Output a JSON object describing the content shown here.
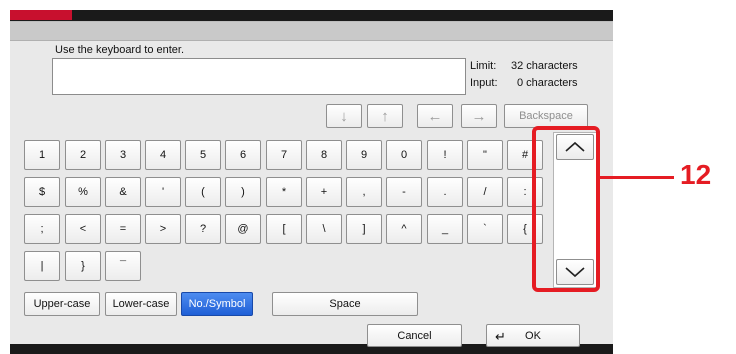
{
  "header": {
    "title": ""
  },
  "prompt": "Use the keyboard to enter.",
  "text_field": {
    "value": ""
  },
  "limits": {
    "limit_label": "Limit:",
    "limit_value": "32 characters",
    "input_label": "Input:",
    "input_value": "0 characters"
  },
  "nav_keys": {
    "down": "↓",
    "up": "↑",
    "left": "←",
    "right": "→",
    "backspace": "Backspace"
  },
  "keys": [
    [
      "1",
      "2",
      "3",
      "4",
      "5",
      "6",
      "7",
      "8",
      "9",
      "0",
      "!",
      "\"",
      "#"
    ],
    [
      "$",
      "%",
      "&",
      "'",
      "(",
      ")",
      "*",
      "+",
      ",",
      "-",
      ".",
      "/",
      ":"
    ],
    [
      ";",
      "<",
      "=",
      ">",
      "?",
      "@",
      "[",
      "\\",
      "]",
      "^",
      "_",
      "`",
      "{"
    ],
    [
      "|",
      "}",
      "¯"
    ]
  ],
  "scroll": {
    "up_icon": "chevron-up-icon",
    "down_icon": "chevron-down-icon"
  },
  "modes": {
    "upper": "Upper-case",
    "lower": "Lower-case",
    "symbol": "No./Symbol",
    "active": "No./Symbol"
  },
  "space_label": "Space",
  "footer": {
    "cancel_label": "Cancel",
    "ok_label": "OK"
  },
  "callout": {
    "number": "12"
  },
  "colors": {
    "accent": "#e51c23",
    "active_mode": "#2f6fe0"
  }
}
